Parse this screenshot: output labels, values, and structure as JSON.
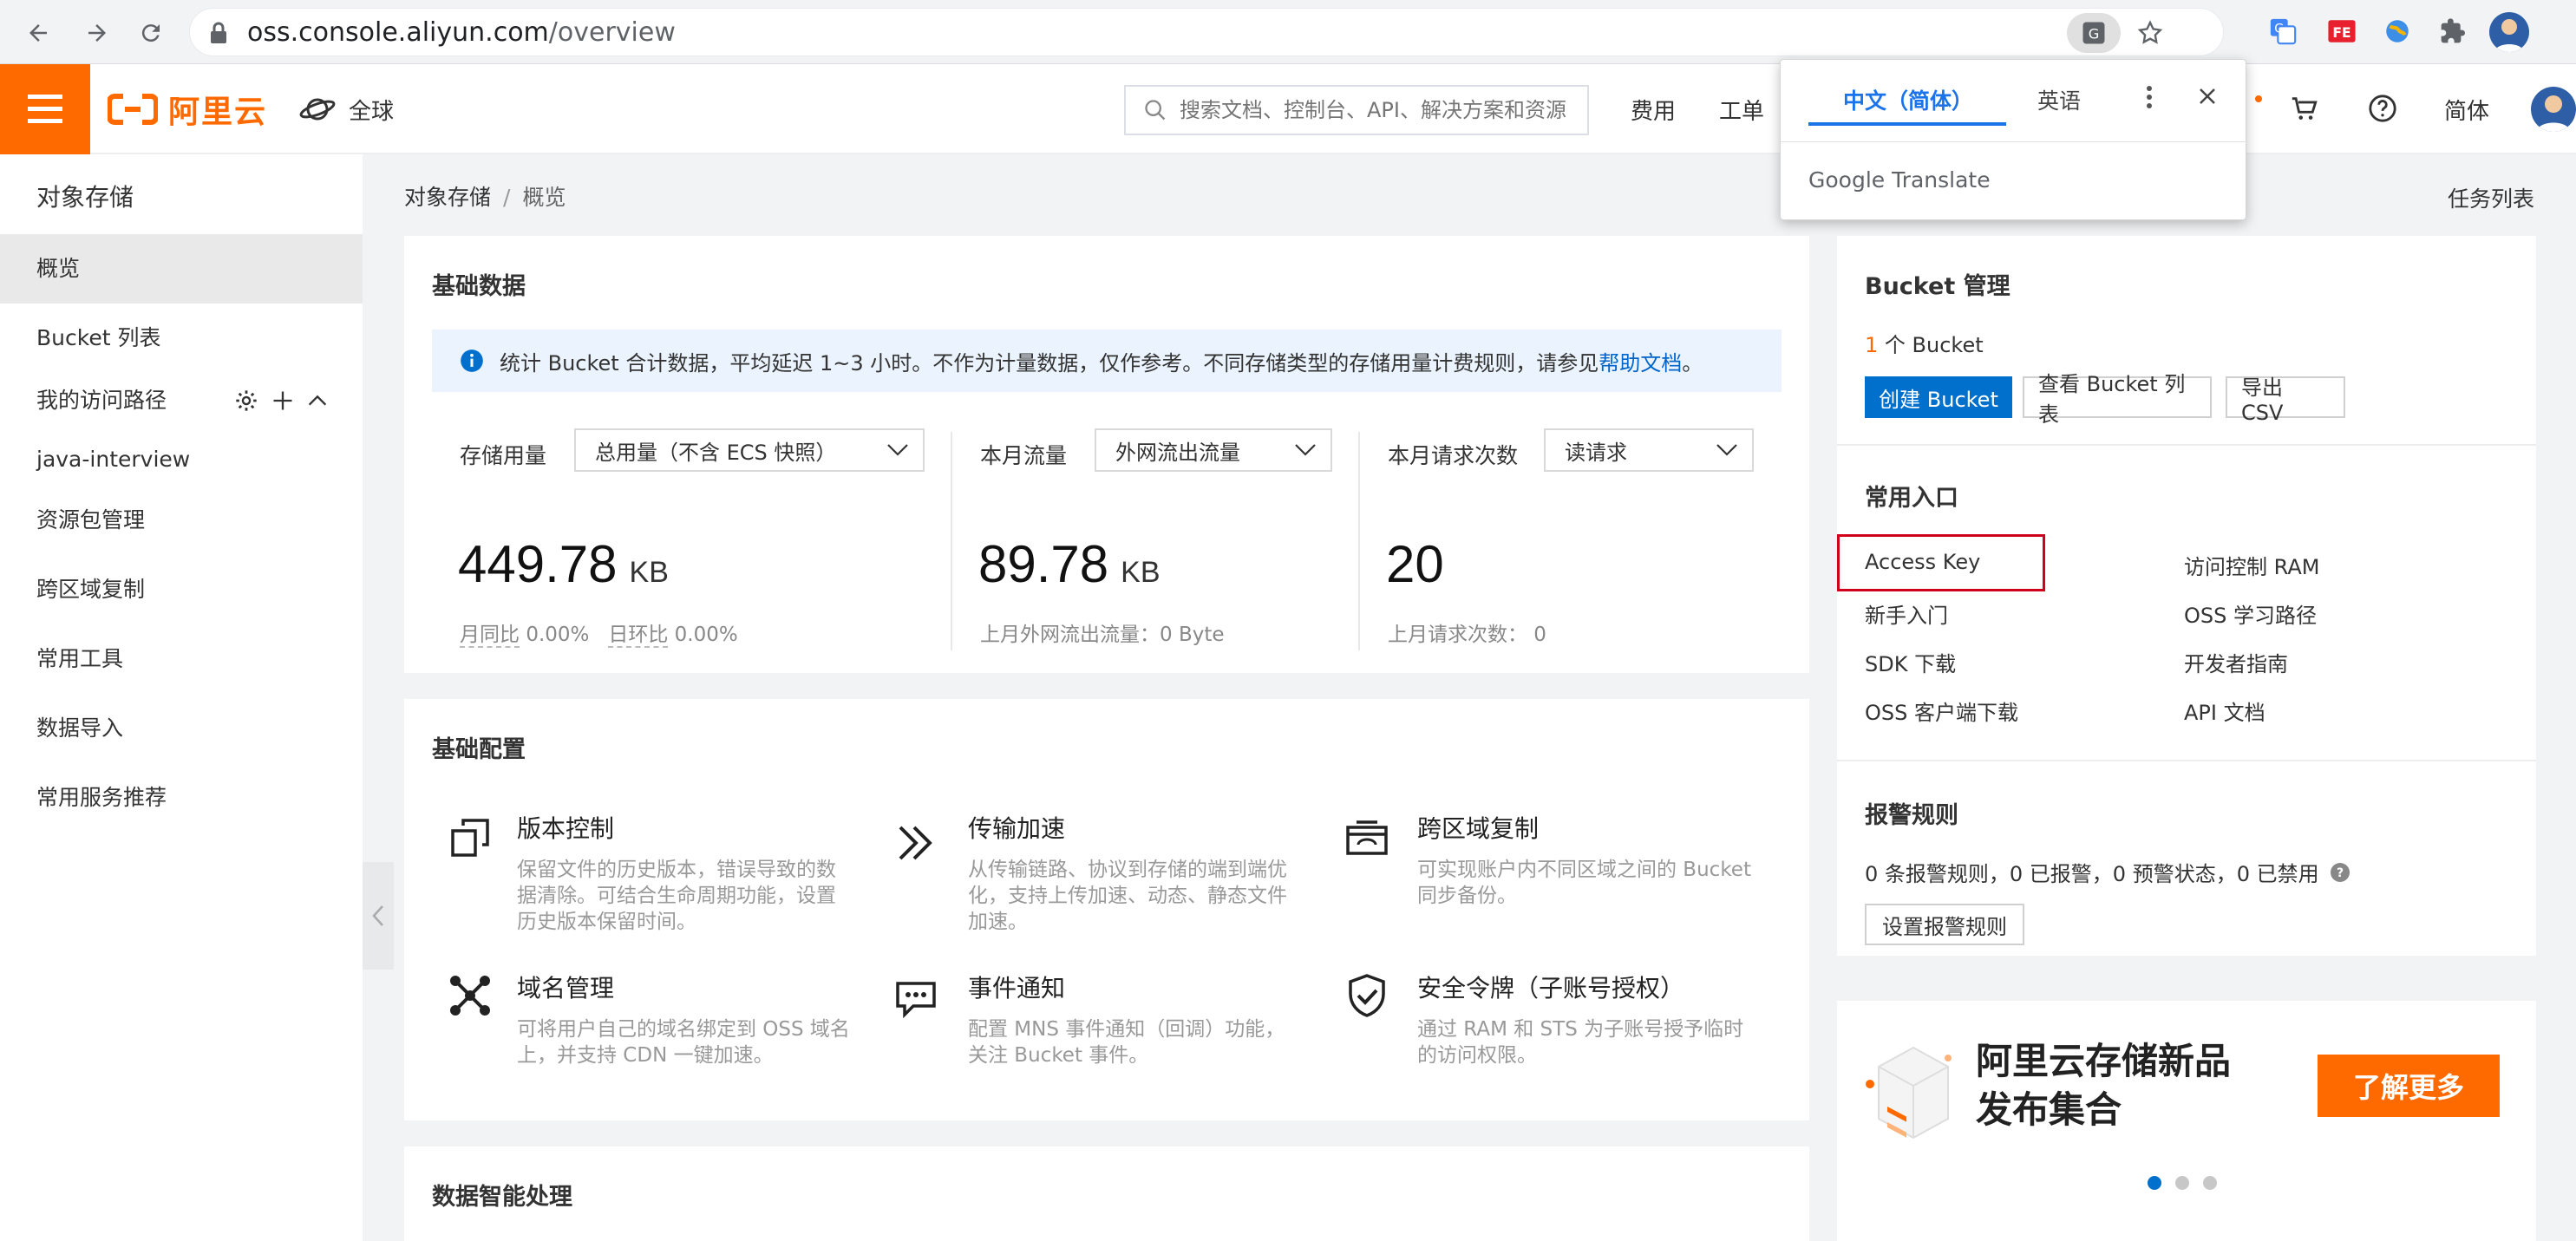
{
  "browser": {
    "url_host": "oss.console.aliyun.com",
    "url_path": "/overview"
  },
  "topnav": {
    "logo_text": "阿里云",
    "region": "全球",
    "search_placeholder": "搜索文档、控制台、API、解决方案和资源",
    "links": [
      "费用",
      "工单"
    ],
    "lang": "简体"
  },
  "translate_popup": {
    "tab_zh": "中文（简体）",
    "tab_en": "英语",
    "brand": "Google Translate"
  },
  "sidebar": {
    "title": "对象存储",
    "items": [
      "概览",
      "Bucket 列表",
      "我的访问路径",
      "java-interview",
      "资源包管理",
      "跨区域复制",
      "常用工具",
      "数据导入",
      "常用服务推荐"
    ]
  },
  "breadcrumb": {
    "root": "对象存储",
    "sep": "/",
    "current": "概览"
  },
  "task_list": "任务列表",
  "basic": {
    "title": "基础数据",
    "info_text": "统计 Bucket 合计数据，平均延迟 1~3 小时。不作为计量数据，仅作参考。不同存储类型的存储用量计费规则，请参见",
    "info_link": "帮助文档",
    "info_end": "。",
    "storage": {
      "label": "存储用量",
      "select": "总用量（不含 ECS 快照）",
      "value": "449.78",
      "unit": "KB",
      "mom_label": "月同比",
      "mom_value": "0.00%",
      "yoy_label": "日环比",
      "yoy_value": "0.00%"
    },
    "traffic": {
      "label": "本月流量",
      "select": "外网流出流量",
      "value": "89.78",
      "unit": "KB",
      "sub": "上月外网流出流量：0 Byte"
    },
    "requests": {
      "label": "本月请求次数",
      "select": "读请求",
      "value": "20",
      "sub": "上月请求次数：  0"
    }
  },
  "config": {
    "title": "基础配置",
    "features": [
      {
        "title": "版本控制",
        "desc": [
          "保留文件的历史版本，错误导致的数",
          "据清除。可结合生命周期功能，设置",
          "历史版本保留时间。"
        ]
      },
      {
        "title": "传输加速",
        "desc": [
          "从传输链路、协议到存储的端到端优",
          "化，支持上传加速、动态、静态文件",
          "加速。"
        ]
      },
      {
        "title": "跨区域复制",
        "desc": [
          "可实现账户内不同区域之间的 Bucket",
          "同步备份。"
        ]
      },
      {
        "title": "域名管理",
        "desc": [
          "可将用户自己的域名绑定到 OSS 域名",
          "上，并支持 CDN 一键加速。"
        ]
      },
      {
        "title": "事件通知",
        "desc": [
          "配置 MNS 事件通知（回调）功能，",
          "关注 Bucket 事件。"
        ]
      },
      {
        "title": "安全令牌（子账号授权）",
        "desc": [
          "通过 RAM 和 STS 为子账号授予临时",
          "的访问权限。"
        ]
      }
    ]
  },
  "smart": {
    "title": "数据智能处理"
  },
  "bucket_mgmt": {
    "title": "Bucket 管理",
    "count": "1",
    "count_suffix": "个 Bucket",
    "btn_create": "创建 Bucket",
    "btn_list": "查看 Bucket 列表",
    "btn_csv": "导出 CSV"
  },
  "entries": {
    "title": "常用入口",
    "items": [
      "Access Key",
      "访问控制 RAM",
      "新手入门",
      "OSS 学习路径",
      "SDK 下载",
      "开发者指南",
      "OSS 客户端下载",
      "API 文档"
    ]
  },
  "alarm": {
    "title": "报警规则",
    "summary": "0 条报警规则，0 已报警，0 预警状态，0 已禁用",
    "btn": "设置报警规则"
  },
  "banner": {
    "line1": "阿里云存储新品",
    "line2": "发布集合",
    "btn": "了解更多"
  },
  "colors": {
    "brand": "#ff6a00",
    "primary": "#0070cc",
    "highlight": "#d0021b"
  }
}
